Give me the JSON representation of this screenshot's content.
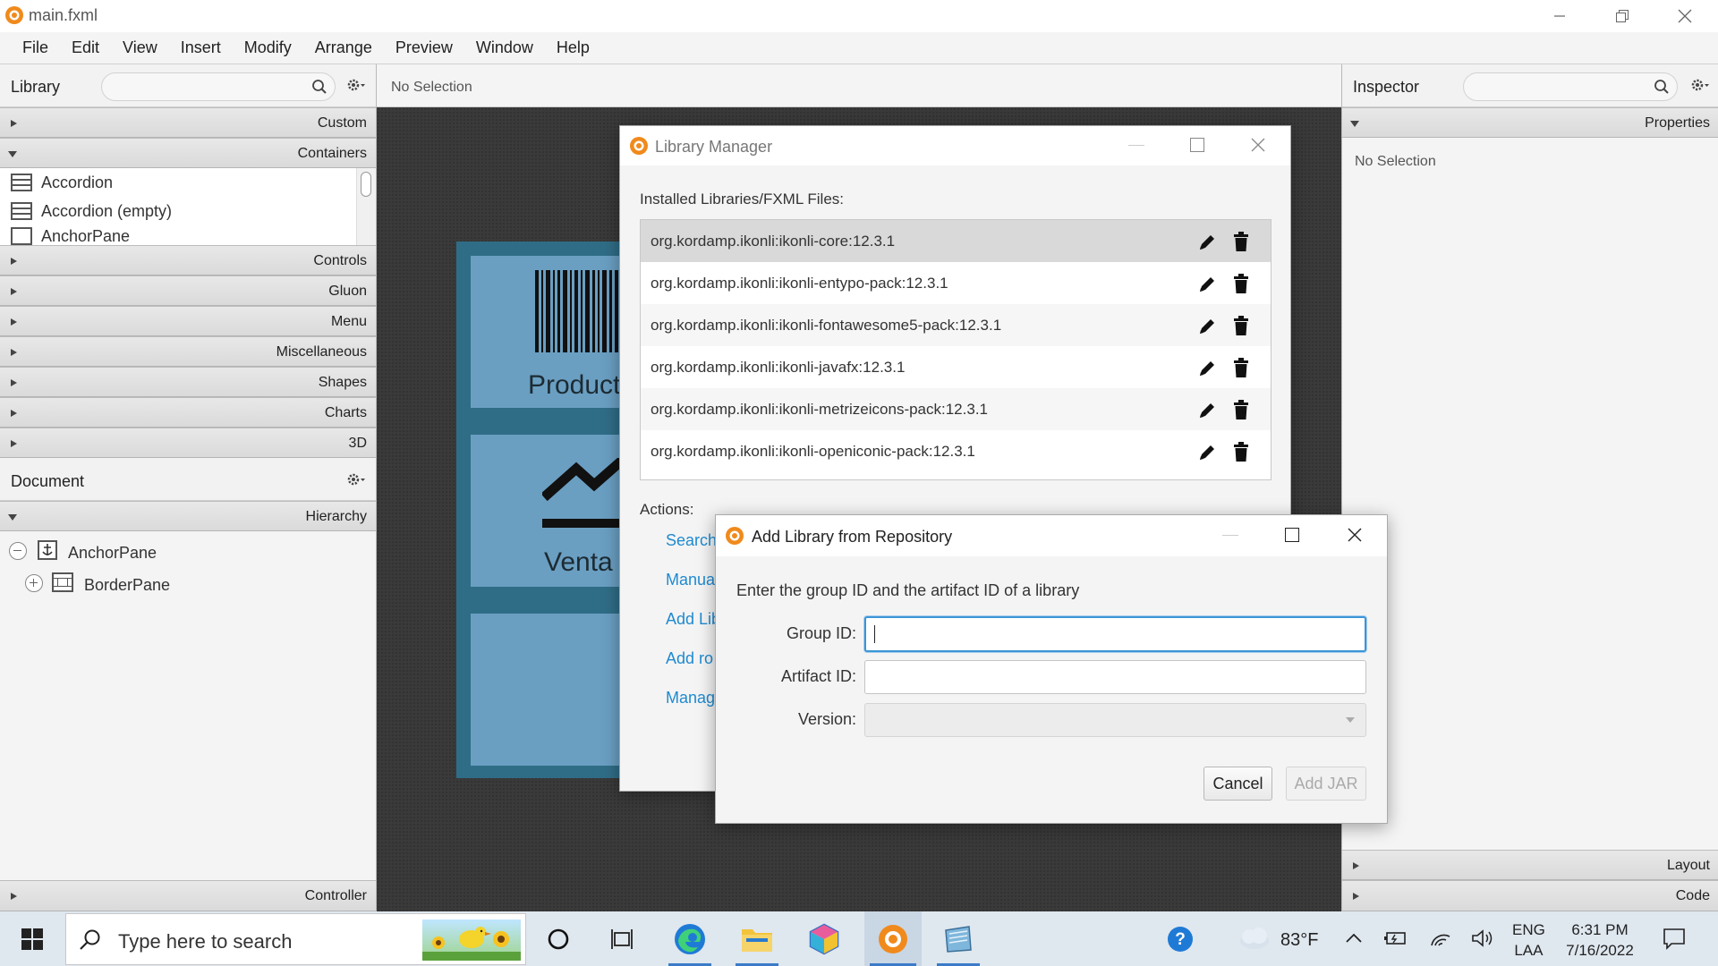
{
  "window": {
    "title": "main.fxml"
  },
  "menu": [
    "File",
    "Edit",
    "View",
    "Insert",
    "Modify",
    "Arrange",
    "Preview",
    "Window",
    "Help"
  ],
  "library": {
    "title": "Library",
    "sections": {
      "custom": "Custom",
      "containers": "Containers",
      "controls": "Controls",
      "gluon": "Gluon",
      "menu": "Menu",
      "misc": "Miscellaneous",
      "shapes": "Shapes",
      "charts": "Charts",
      "threed": "3D"
    },
    "items": [
      "Accordion",
      "Accordion  (empty)",
      "AnchorPane"
    ]
  },
  "document": {
    "title": "Document",
    "hierarchy_label": "Hierarchy",
    "nodes": [
      "AnchorPane",
      "BorderPane"
    ],
    "controller_label": "Controller"
  },
  "center": {
    "selection": "No Selection",
    "cards": [
      "Product",
      "Venta"
    ]
  },
  "inspector": {
    "title": "Inspector",
    "properties_label": "Properties",
    "no_selection": "No Selection",
    "layout_label": "Layout",
    "code_label": "Code"
  },
  "library_manager": {
    "title": "Library Manager",
    "installed_label": "Installed Libraries/FXML Files:",
    "libraries": [
      "org.kordamp.ikonli:ikonli-core:12.3.1",
      "org.kordamp.ikonli:ikonli-entypo-pack:12.3.1",
      "org.kordamp.ikonli:ikonli-fontawesome5-pack:12.3.1",
      "org.kordamp.ikonli:ikonli-javafx:12.3.1",
      "org.kordamp.ikonli:ikonli-metrizeicons-pack:12.3.1",
      "org.kordamp.ikonli:ikonli-openiconic-pack:12.3.1"
    ],
    "actions_label": "Actions:",
    "actions": [
      "Search",
      "Manua",
      "Add Lib",
      "Add ro",
      "Manag"
    ]
  },
  "add_library_dialog": {
    "title": "Add Library from Repository",
    "instruction": "Enter the group ID and the artifact ID of a library",
    "group_label": "Group ID:",
    "group_value": "",
    "artifact_label": "Artifact ID:",
    "artifact_value": "",
    "version_label": "Version:",
    "version_value": "",
    "cancel_label": "Cancel",
    "add_label": "Add JAR"
  },
  "taskbar": {
    "search_placeholder": "Type here to search",
    "weather": "83°F",
    "lang1": "ENG",
    "lang2": "LAA",
    "time": "6:31 PM",
    "date": "7/16/2022"
  },
  "colors": {
    "accent_link": "#1f8ad0",
    "card_blue": "#6a9fc2",
    "card_frame": "#2f6d86",
    "app_orange": "#f08a1c"
  }
}
